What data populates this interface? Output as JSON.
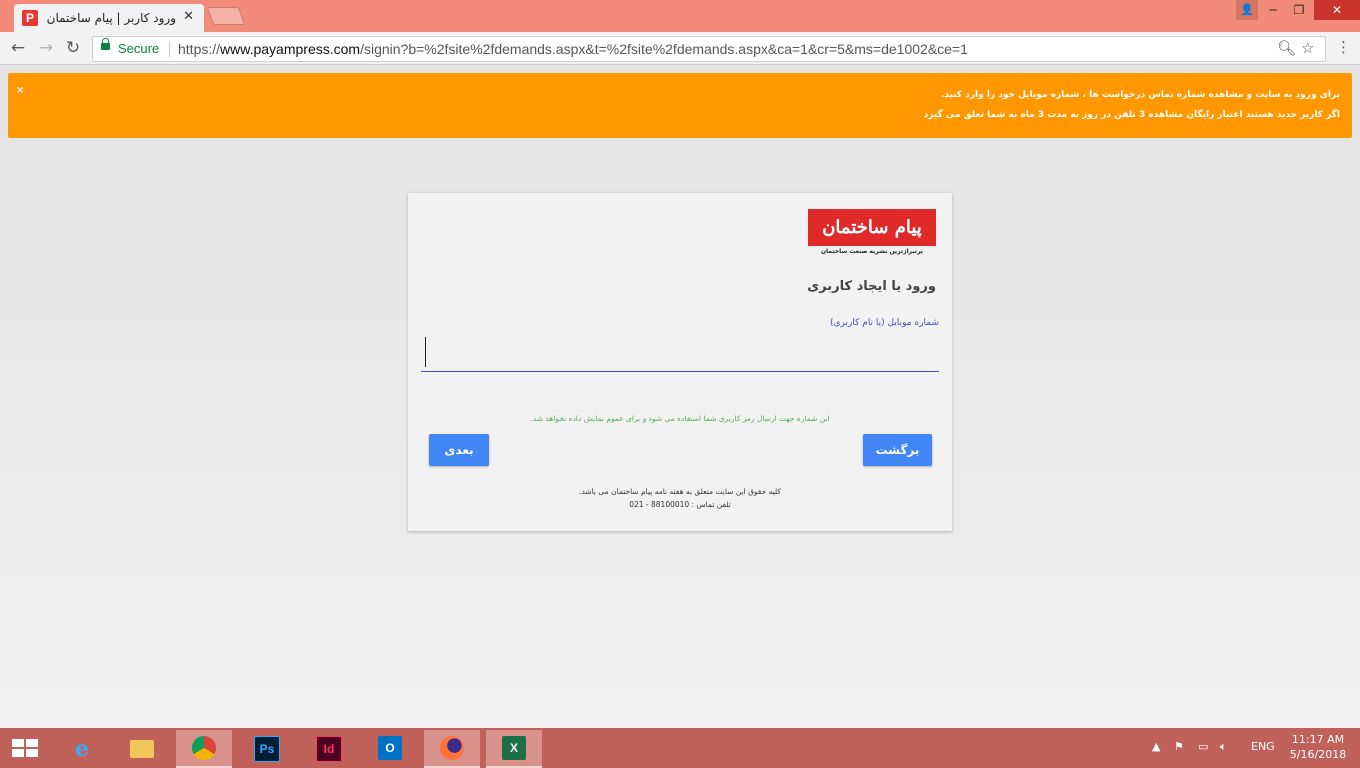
{
  "browser": {
    "tab_title": "ورود کاربر | پیام ساختمان",
    "tab_favicon_letter": "P",
    "secure_label": "Secure",
    "url_scheme": "https://",
    "url_host": "www.payampress.com",
    "url_path": "/signin?b=%2fsite%2fdemands.aspx&t=%2fsite%2fdemands.aspx&ca=1&cr=5&ms=de1002&ce=1"
  },
  "notice": {
    "close_label": "×",
    "line1": "برای ورود به سایت و مشاهده شماره تماس درخواست ها ، شماره موبایل خود را وارد کنید.",
    "line2": "اگر کاربر جدید هستید اعتبار رایگان مشاهده 3 تلفن در روز به مدت 3 ماه به شما تعلق می گیرد"
  },
  "login": {
    "logo_text": "پیام ساختمان",
    "logo_subtitle": "پرتیراژترین نشریه صنعت ساختمان",
    "heading": "ورود یا ایجاد کاربری",
    "field_label": "شماره موبایل (یا نام کاربری)",
    "field_value": "",
    "hint": "این شماره جهت ارسال رمز کاربری شما استفاده می شود و برای عموم نمایش داده نخواهد شد.",
    "next_button": "بعدی",
    "back_button": "برگشت",
    "footer_line1": "کلیه حقوق این سایت متعلق به هفته نامه پیام ساختمان می باشد.",
    "footer_line2": "تلفن تماس : 88100010 - 021"
  },
  "taskbar": {
    "apps": [
      {
        "name": "internet-explorer",
        "label": "e"
      },
      {
        "name": "file-explorer",
        "label": ""
      },
      {
        "name": "chrome",
        "label": ""
      },
      {
        "name": "photoshop",
        "label": "Ps"
      },
      {
        "name": "indesign",
        "label": "Id"
      },
      {
        "name": "firefox",
        "label": ""
      },
      {
        "name": "outlook",
        "label": "O"
      },
      {
        "name": "excel",
        "label": "X"
      }
    ],
    "language": "ENG",
    "time": "11:17 AM",
    "date": "5/16/2018"
  },
  "colors": {
    "titlebar": "#f28b79",
    "notice": "#ff9800",
    "button": "#4285f4",
    "logo": "#e02a2a",
    "secure": "#0b8043"
  }
}
